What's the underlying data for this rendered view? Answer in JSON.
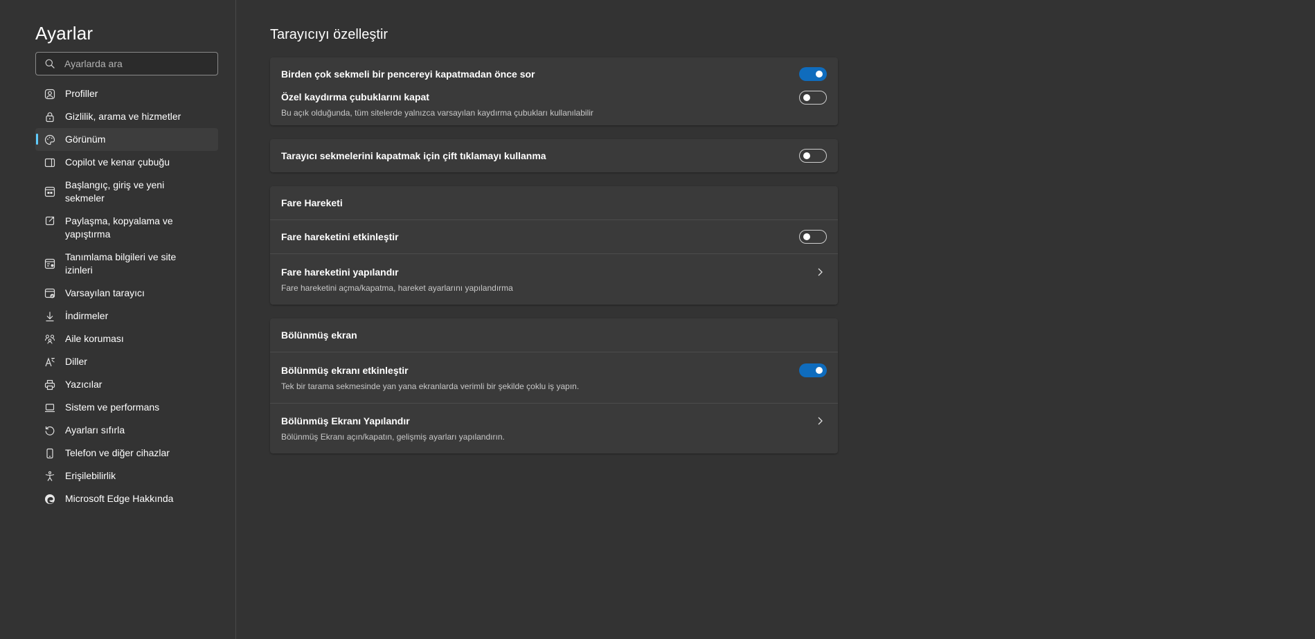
{
  "sidebar": {
    "title": "Ayarlar",
    "search_placeholder": "Ayarlarda ara",
    "items": [
      {
        "label": "Profiller",
        "icon": "profile-icon"
      },
      {
        "label": "Gizlilik, arama ve hizmetler",
        "icon": "lock-icon"
      },
      {
        "label": "Görünüm",
        "icon": "appearance-icon",
        "active": true
      },
      {
        "label": "Copilot ve kenar çubuğu",
        "icon": "sidebar-icon"
      },
      {
        "label": "Başlangıç, giriş ve yeni sekmeler",
        "icon": "home-tab-icon"
      },
      {
        "label": "Paylaşma, kopyalama ve yapıştırma",
        "icon": "share-icon"
      },
      {
        "label": "Tanımlama bilgileri ve site izinleri",
        "icon": "cookies-icon"
      },
      {
        "label": "Varsayılan tarayıcı",
        "icon": "default-browser-icon"
      },
      {
        "label": "İndirmeler",
        "icon": "download-icon"
      },
      {
        "label": "Aile koruması",
        "icon": "family-icon"
      },
      {
        "label": "Diller",
        "icon": "language-icon"
      },
      {
        "label": "Yazıcılar",
        "icon": "printer-icon"
      },
      {
        "label": "Sistem ve performans",
        "icon": "laptop-icon"
      },
      {
        "label": "Ayarları sıfırla",
        "icon": "reset-icon"
      },
      {
        "label": "Telefon ve diğer cihazlar",
        "icon": "phone-icon"
      },
      {
        "label": "Erişilebilirlik",
        "icon": "accessibility-icon"
      },
      {
        "label": "Microsoft Edge Hakkında",
        "icon": "edge-logo-icon"
      }
    ]
  },
  "main": {
    "title": "Tarayıcıyı özelleştir",
    "card1": {
      "row1": {
        "label": "Birden çok sekmeli bir pencereyi kapatmadan önce sor",
        "on": true
      },
      "row2": {
        "label": "Özel kaydırma çubuklarını kapat",
        "desc": "Bu açık olduğunda, tüm sitelerde yalnızca varsayılan kaydırma çubukları kullanılabilir",
        "on": false
      }
    },
    "card2": {
      "row1": {
        "label": "Tarayıcı sekmelerini kapatmak için çift tıklamayı kullanma",
        "on": false
      }
    },
    "card3": {
      "header": "Fare Hareketi",
      "row1": {
        "label": "Fare hareketini etkinleştir",
        "on": false
      },
      "row2": {
        "label": "Fare hareketini yapılandır",
        "desc": "Fare hareketini açma/kapatma, hareket ayarlarını yapılandırma"
      }
    },
    "card4": {
      "header": "Bölünmüş ekran",
      "row1": {
        "label": "Bölünmüş ekranı etkinleştir",
        "desc": "Tek bir tarama sekmesinde yan yana ekranlarda verimli bir şekilde çoklu iş yapın.",
        "on": true
      },
      "row2": {
        "label": "Bölünmüş Ekranı Yapılandır",
        "desc": "Bölünmüş Ekranı açın/kapatın, gelişmiş ayarları yapılandırın."
      }
    }
  },
  "colors": {
    "accent": "#0f6cbd",
    "indicator": "#60cdff",
    "background": "#333333",
    "card": "#3a3a3a"
  }
}
